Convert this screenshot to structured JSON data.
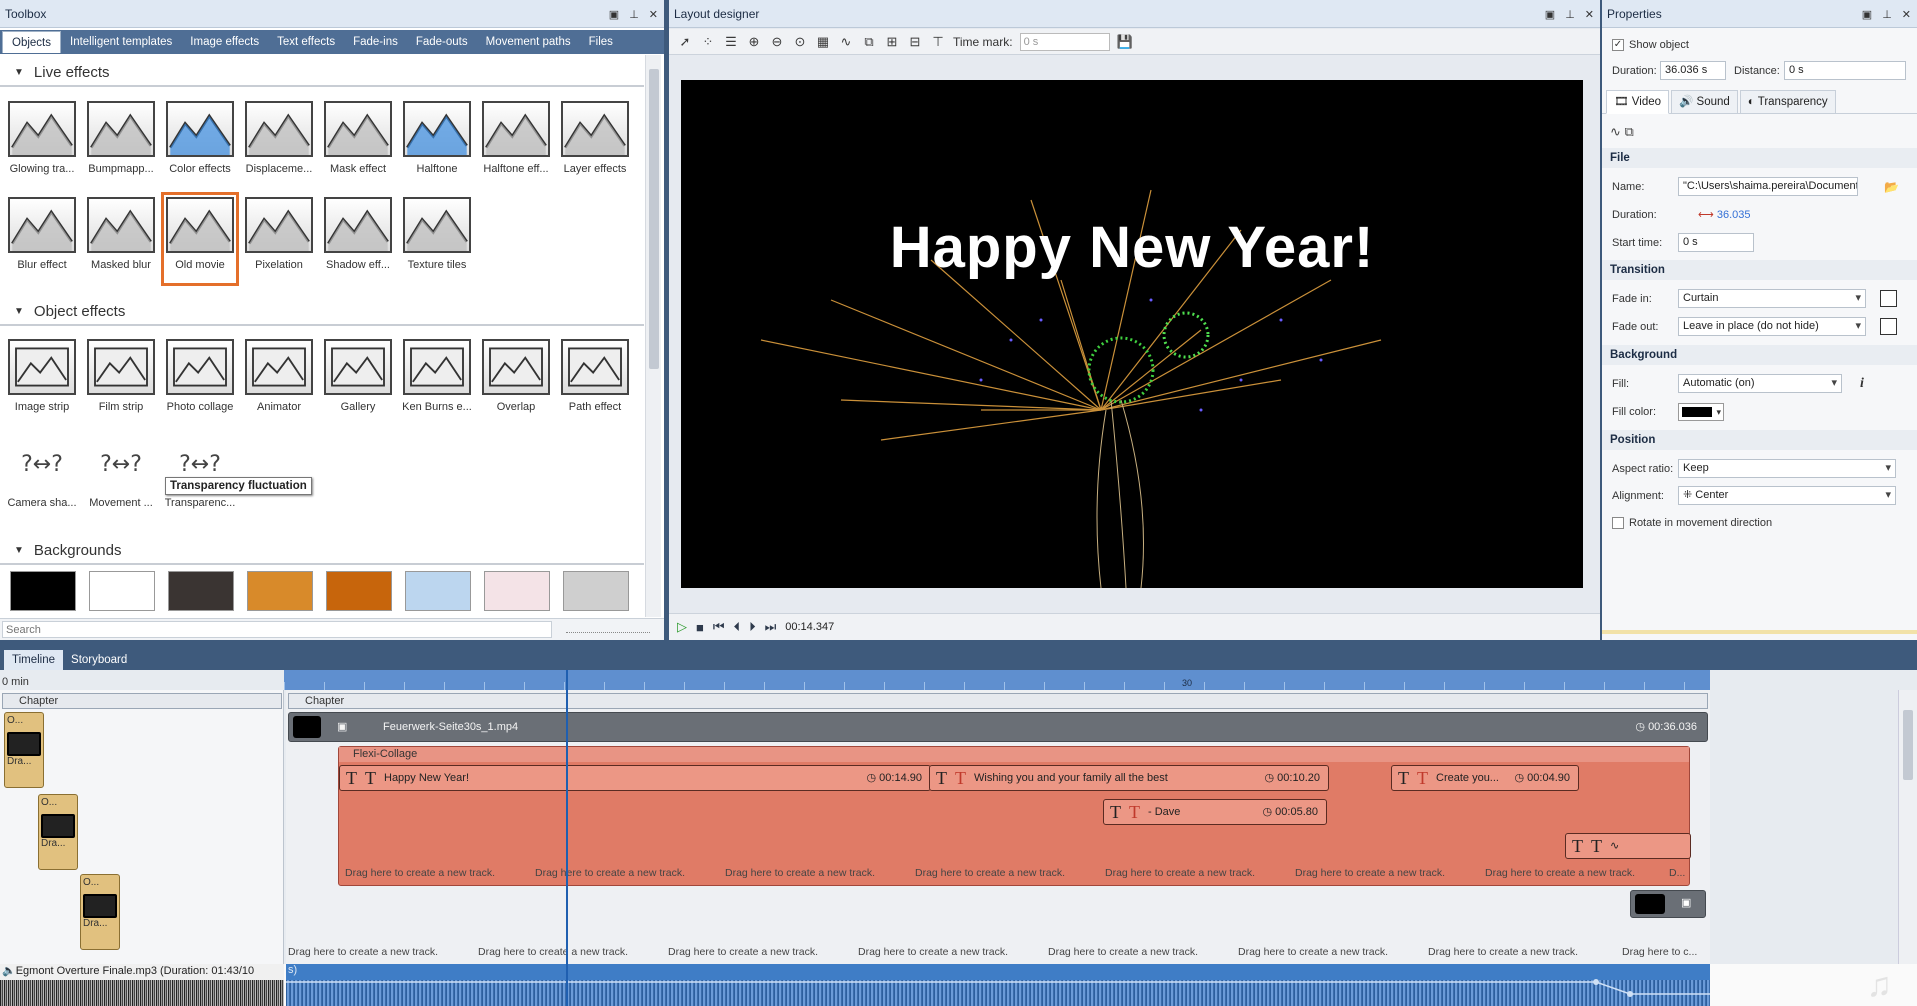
{
  "toolbox": {
    "title": "Toolbox",
    "tabs": [
      "Objects",
      "Intelligent templates",
      "Image effects",
      "Text effects",
      "Fade-ins",
      "Fade-outs",
      "Movement paths",
      "Files"
    ],
    "sections": {
      "live_effects": "Live effects",
      "object_effects": "Object effects",
      "backgrounds": "Backgrounds"
    },
    "live_effects": [
      "Glowing tra...",
      "Bumpmapp...",
      "Color effects",
      "Displaceme...",
      "Mask effect",
      "Halftone",
      "Halftone eff...",
      "Layer effects",
      "Blur effect",
      "Masked blur",
      "Old movie",
      "Pixelation",
      "Shadow eff...",
      "Texture tiles"
    ],
    "object_effects": [
      "Image strip",
      "Film strip",
      "Photo collage",
      "Animator",
      "Gallery",
      "Ken Burns e...",
      "Overlap",
      "Path effect",
      "Camera sha...",
      "Movement ...",
      "Transparenc..."
    ],
    "tooltip": "Transparency fluctuation",
    "search_placeholder": "Search"
  },
  "designer": {
    "title": "Layout designer",
    "time_mark_label": "Time mark:",
    "time_mark_value": "0 s",
    "canvas_text": "Happy New Year!",
    "playback_time": "00:14.347"
  },
  "properties": {
    "title": "Properties",
    "show_object": "Show object",
    "duration_label": "Duration:",
    "duration_value": "36.036 s",
    "distance_label": "Distance:",
    "distance_value": "0 s",
    "tabs": [
      "Video",
      "Sound",
      "Transparency"
    ],
    "file_section": "File",
    "name_label": "Name:",
    "name_value": "\"C:\\Users\\shaima.pereira\\Documents\\Ex",
    "file_duration_label": "Duration:",
    "file_duration_value": "36.035",
    "start_label": "Start time:",
    "start_value": "0 s",
    "transition_section": "Transition",
    "fadein_label": "Fade in:",
    "fadein_value": "Curtain",
    "fadeout_label": "Fade out:",
    "fadeout_value": "Leave in place (do not hide)",
    "background_section": "Background",
    "fill_label": "Fill:",
    "fill_value": "Automatic (on)",
    "fillcolor_label": "Fill color:",
    "position_section": "Position",
    "aspect_label": "Aspect ratio:",
    "aspect_value": "Keep",
    "align_label": "Alignment:",
    "align_value": "Center",
    "rotate_label": "Rotate in movement direction"
  },
  "timeline": {
    "tabs": [
      "Timeline",
      "Storyboard"
    ],
    "ruler_left": "0 min",
    "ruler_mark": "30",
    "chapter": "Chapter",
    "video_clip": "Feuerwerk-Seite30s_1.mp4",
    "video_duration": "00:36.036",
    "collage": "Flexi-Collage",
    "thumb_labels": [
      "O...",
      "Dra..."
    ],
    "clips": [
      {
        "text": "Happy New Year!",
        "dur": "00:14.90"
      },
      {
        "text": "Wishing you and your family all the best",
        "dur": "00:10.20"
      },
      {
        "text": "Create you...",
        "dur": "00:04.90"
      },
      {
        "text": "- Dave",
        "dur": "00:05.80"
      }
    ],
    "drop_hint": "Drag here to create a new track.",
    "drop_hint_short": "D...",
    "drop_hint_tail": "Drag here to c...",
    "audio_name": "Egmont Overture Finale.mp3 (Duration: 01:43/10",
    "audio_suffix": "s)"
  }
}
